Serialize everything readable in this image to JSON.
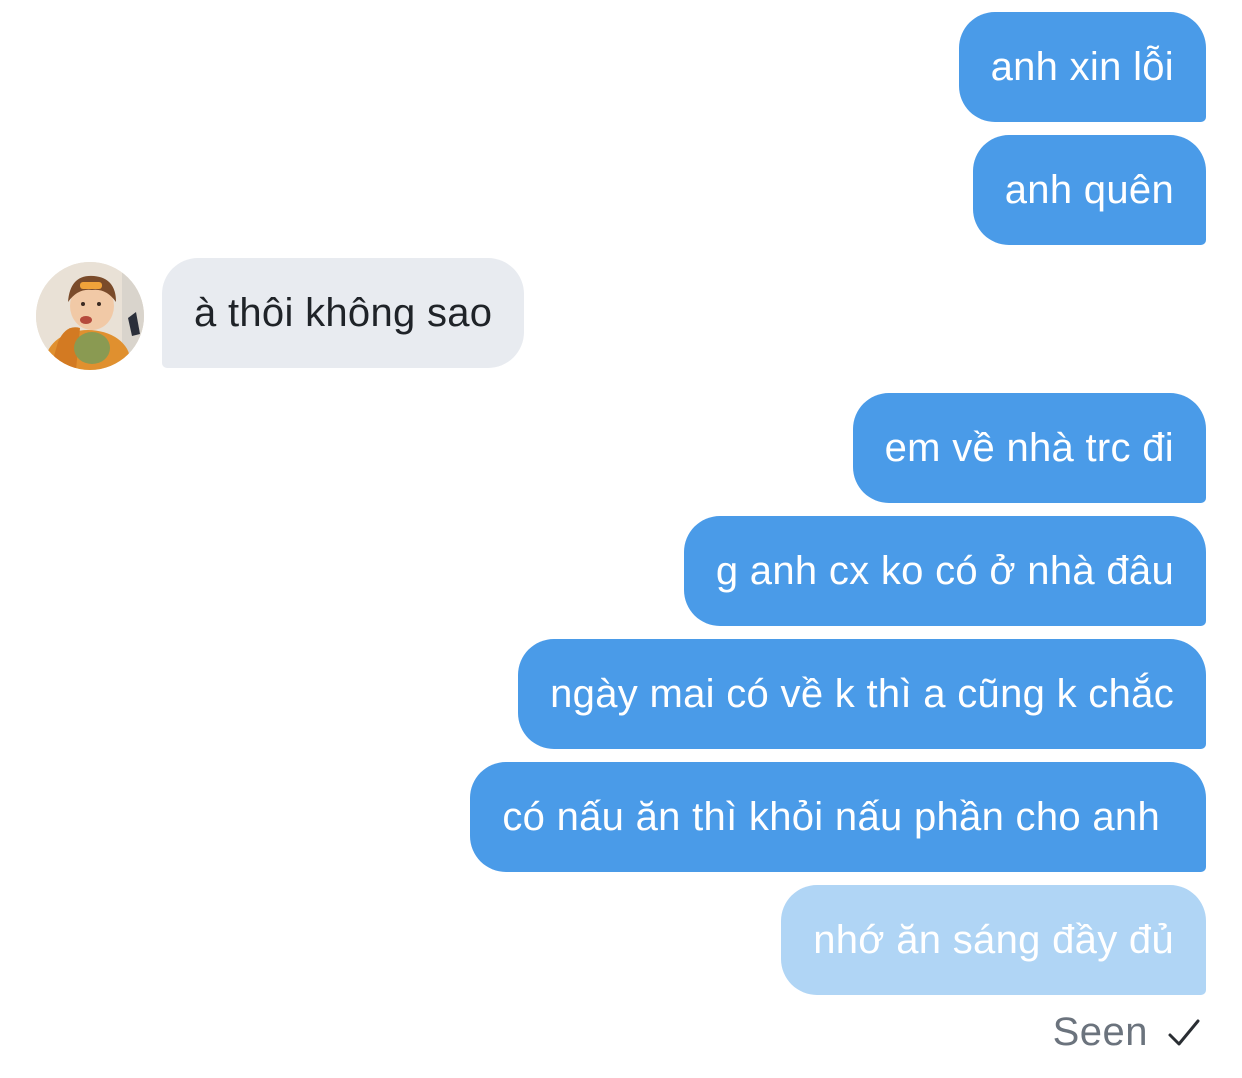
{
  "messages": [
    {
      "direction": "outgoing",
      "text": "anh xin lỗi"
    },
    {
      "direction": "outgoing",
      "text": "anh quên"
    },
    {
      "direction": "incoming",
      "text": "à thôi không sao",
      "avatar": "profile-photo"
    },
    {
      "direction": "outgoing",
      "text": "em về nhà trc đi"
    },
    {
      "direction": "outgoing",
      "text": "g anh cx ko có ở nhà đâu"
    },
    {
      "direction": "outgoing",
      "text": "ngày mai có về k thì a cũng k chắc"
    },
    {
      "direction": "outgoing",
      "text": "có nấu ăn thì khỏi nấu phần cho anh"
    },
    {
      "direction": "outgoing",
      "text": "nhớ ăn sáng đầy đủ",
      "state": "pending"
    }
  ],
  "status": {
    "label": "Seen",
    "icon": "checkmark-icon"
  },
  "colors": {
    "outgoing_bubble": "#4a9be8",
    "outgoing_pending_bubble": "#b0d5f5",
    "incoming_bubble": "#e8ebf0",
    "status_text": "#6b737d"
  }
}
